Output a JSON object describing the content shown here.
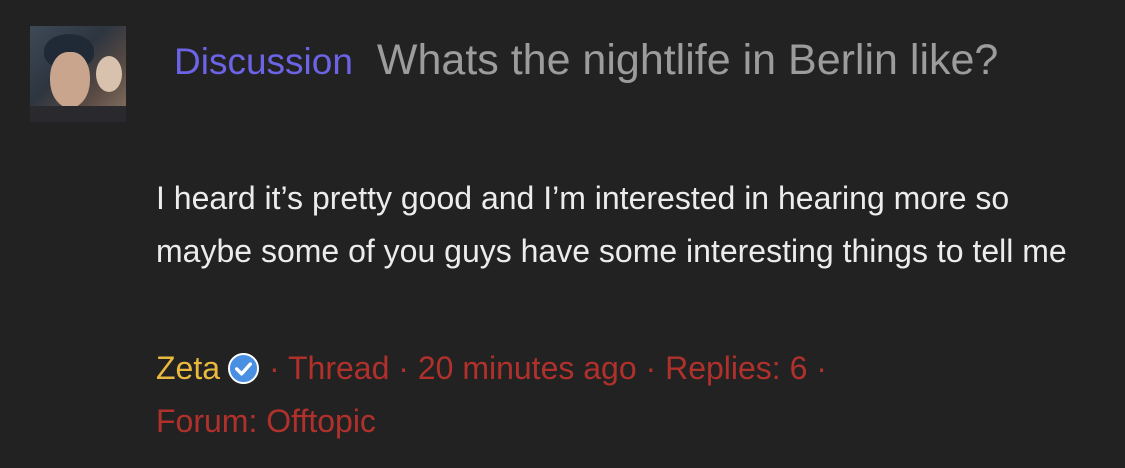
{
  "thread": {
    "prefix": "Discussion",
    "title": "Whats the nightlife in Berlin like?",
    "body": "I heard it’s pretty good and I’m interested in hearing more so maybe some of you guys have some interesting things to tell me",
    "author": "Zeta",
    "type": "Thread",
    "time": "20 minutes ago",
    "replies": "Replies: 6",
    "forum": "Forum: Offtopic"
  },
  "colors": {
    "background": "#222222",
    "prefix": "#6c63e6",
    "title": "#9c9c9c",
    "body": "#ececec",
    "author": "#e8b93c",
    "meta": "#b0312b",
    "verified_badge": "#4a90e2"
  },
  "icons": {
    "verified": "verified-check-icon",
    "avatar": "user-avatar"
  }
}
